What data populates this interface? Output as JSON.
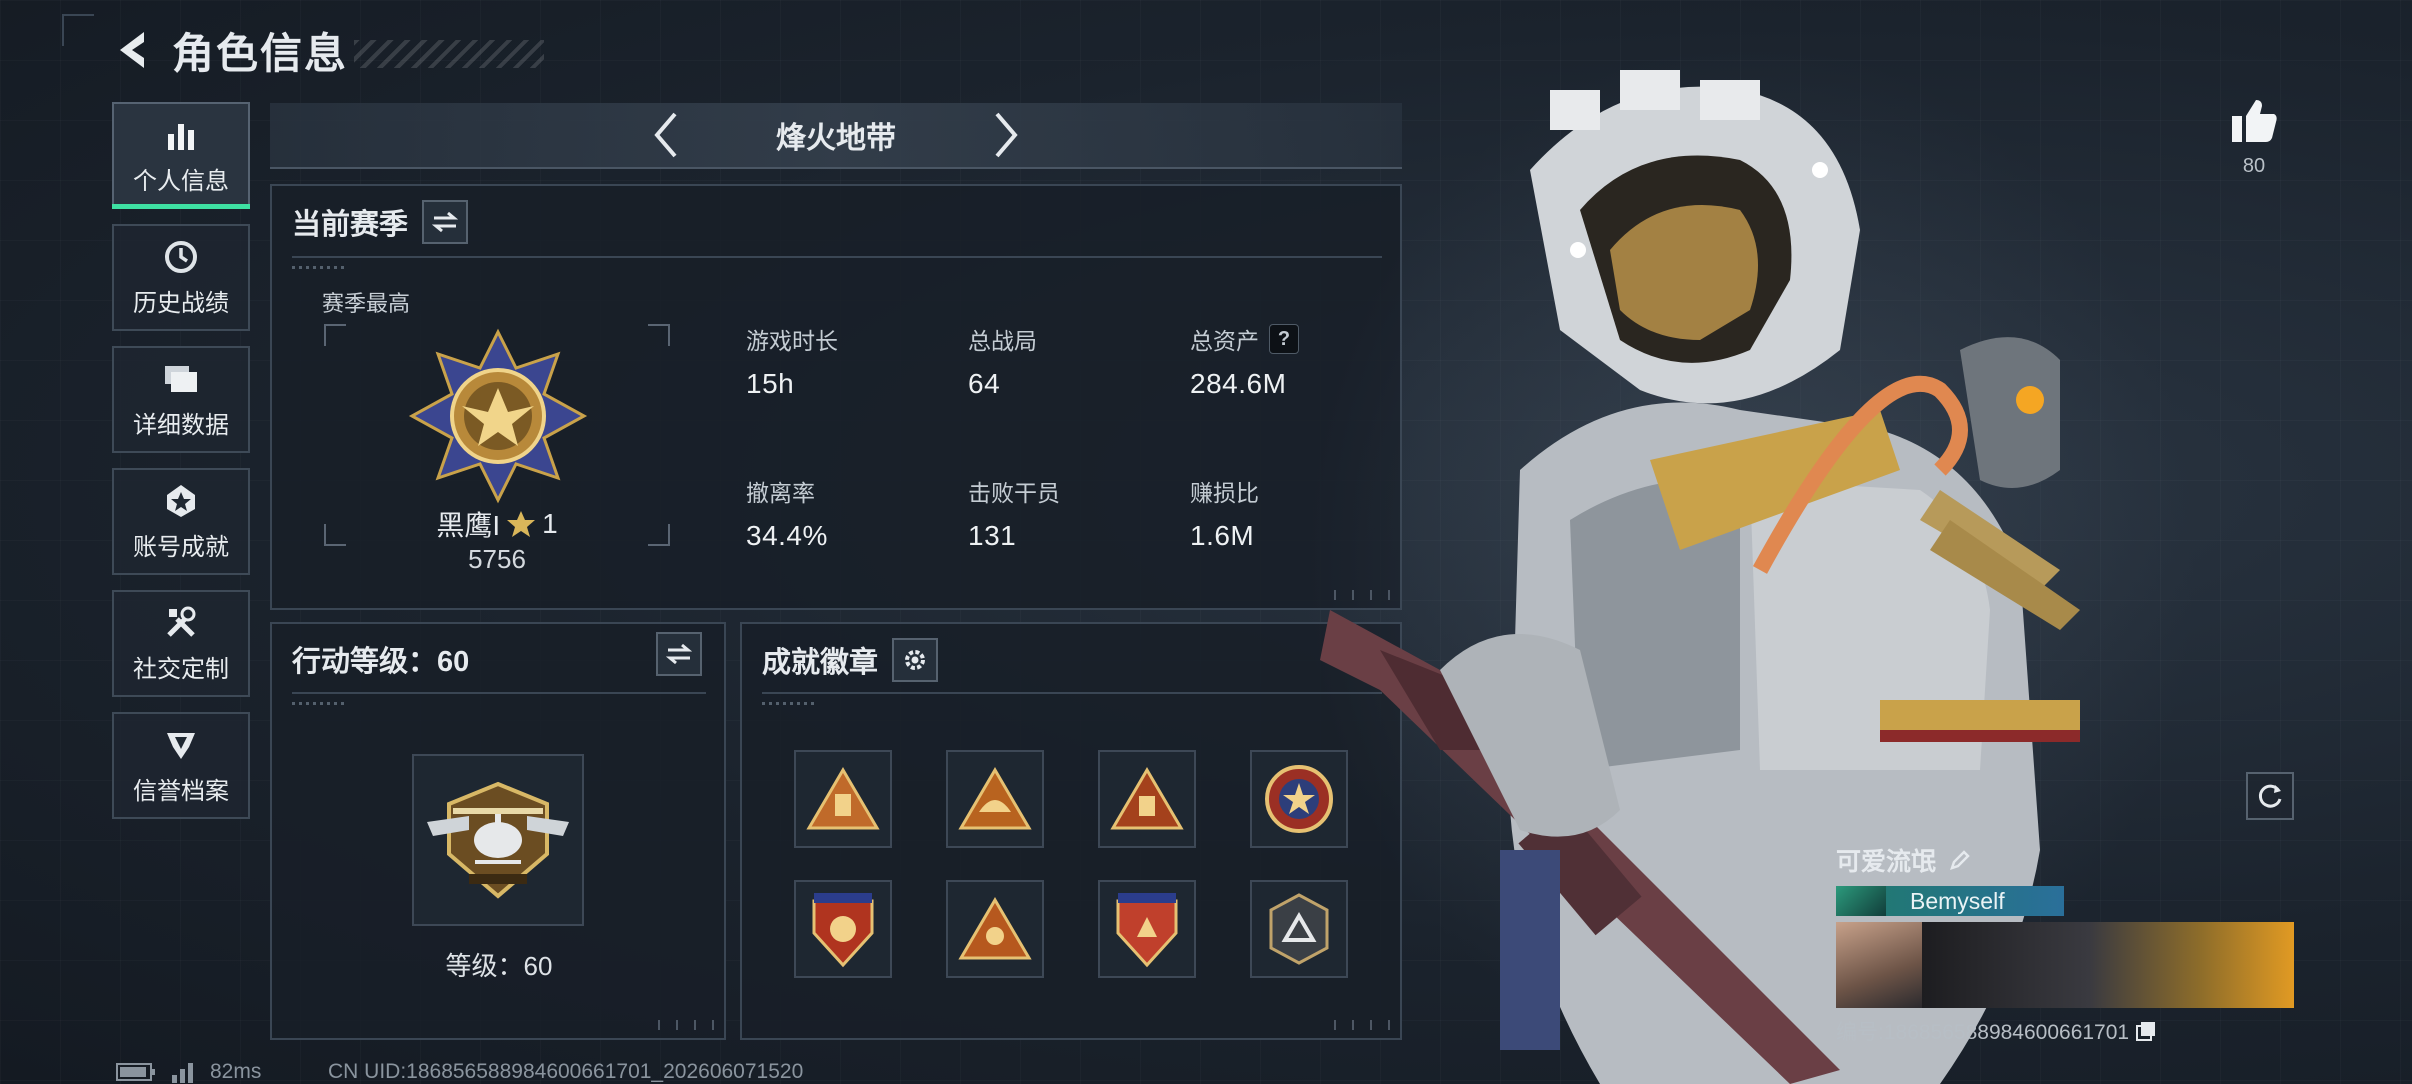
{
  "header": {
    "title": "角色信息"
  },
  "sidebar": {
    "items": [
      {
        "label": "个人信息",
        "icon": "bar-chart-icon"
      },
      {
        "label": "历史战绩",
        "icon": "history-clock-icon"
      },
      {
        "label": "详细数据",
        "icon": "folder-stack-icon"
      },
      {
        "label": "账号成就",
        "icon": "achievement-icon"
      },
      {
        "label": "社交定制",
        "icon": "tools-icon"
      },
      {
        "label": "信誉档案",
        "icon": "reputation-icon"
      }
    ]
  },
  "mode": {
    "name": "烽火地带"
  },
  "season": {
    "title": "当前赛季",
    "best_label": "赛季最高",
    "rank_name": "黑鹰I",
    "rank_stars": "1",
    "rank_score": "5756",
    "stats": [
      {
        "label": "游戏时长",
        "value": "15h"
      },
      {
        "label": "总战局",
        "value": "64"
      },
      {
        "label": "总资产",
        "value": "284.6M",
        "help": "?"
      },
      {
        "label": "撤离率",
        "value": "34.4%"
      },
      {
        "label": "击败干员",
        "value": "131"
      },
      {
        "label": "赚损比",
        "value": "1.6M"
      }
    ]
  },
  "action_level": {
    "title": "行动等级：60",
    "level_text": "等级：60"
  },
  "achievement_badges": {
    "title": "成就徽章",
    "count": 8
  },
  "like": {
    "count": "80"
  },
  "player_card": {
    "name": "可爱流氓",
    "tag": "Bemyself",
    "id_text": "编号:1868565889846006617​01"
  },
  "status": {
    "ping": "82ms",
    "uid": "CN UID:1868565889846006617​01_202606071520"
  },
  "colors": {
    "accent": "#3ee1a3",
    "gold": "#c9a24a"
  }
}
